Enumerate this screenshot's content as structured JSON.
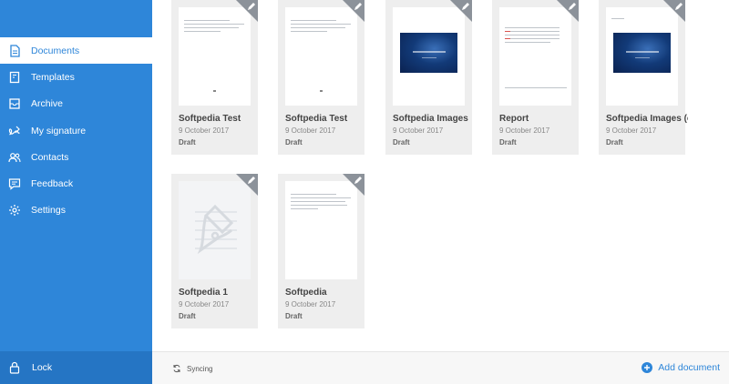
{
  "sidebar": {
    "items": [
      {
        "label": "Documents",
        "icon": "document-icon",
        "active": true
      },
      {
        "label": "Templates",
        "icon": "template-icon",
        "active": false
      },
      {
        "label": "Archive",
        "icon": "archive-icon",
        "active": false
      },
      {
        "label": "My signature",
        "icon": "signature-icon",
        "active": false
      },
      {
        "label": "Contacts",
        "icon": "contacts-icon",
        "active": false
      },
      {
        "label": "Feedback",
        "icon": "feedback-icon",
        "active": false
      },
      {
        "label": "Settings",
        "icon": "gear-icon",
        "active": false
      }
    ],
    "lock_label": "Lock"
  },
  "documents": [
    {
      "title": "Softpedia Test",
      "date": "9 October 2017",
      "status": "Draft",
      "thumb": "text"
    },
    {
      "title": "Softpedia Test",
      "date": "9 October 2017",
      "status": "Draft",
      "thumb": "text"
    },
    {
      "title": "Softpedia Images",
      "date": "9 October 2017",
      "status": "Draft",
      "thumb": "image"
    },
    {
      "title": "Report",
      "date": "9 October 2017",
      "status": "Draft",
      "thumb": "table"
    },
    {
      "title": "Softpedia Images (c",
      "date": "9 October 2017",
      "status": "Draft",
      "thumb": "image"
    },
    {
      "title": "Softpedia 1",
      "date": "9 October 2017",
      "status": "Draft",
      "thumb": "placeholder"
    },
    {
      "title": "Softpedia",
      "date": "9 October 2017",
      "status": "Draft",
      "thumb": "text"
    }
  ],
  "footer": {
    "sync_label": "Syncing",
    "add_document_label": "Add document"
  },
  "colors": {
    "accent": "#2e86d9",
    "sidebar_dark": "#2575c4",
    "card_bg": "#eeeeee",
    "corner_badge": "#8c929a"
  }
}
